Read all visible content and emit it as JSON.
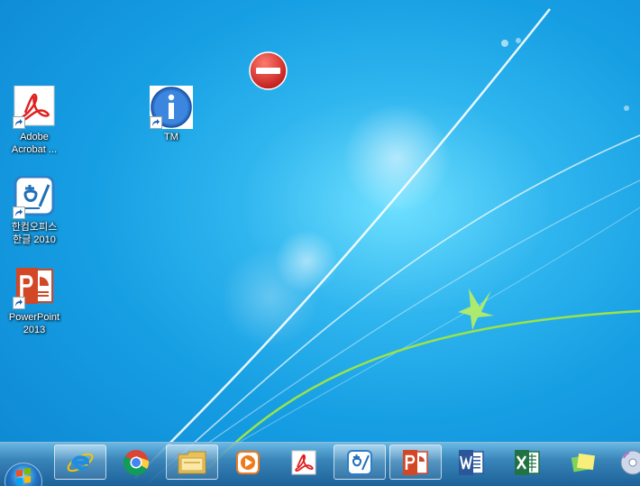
{
  "desktop": {
    "icons": [
      {
        "label1": "Adobe",
        "label2": "Acrobat ...",
        "icon": "pdf-icon"
      },
      {
        "label1": "TM",
        "label2": "",
        "icon": "info-icon"
      },
      {
        "label1": "한컴오피스",
        "label2": "한글 2010",
        "icon": "hangul-icon"
      },
      {
        "label1": "PowerPoint",
        "label2": "2013",
        "icon": "powerpoint-icon"
      }
    ],
    "overlay_icon": "no-entry-icon"
  },
  "taskbar": {
    "start": "windows-start-orb",
    "items": [
      {
        "icon": "internet-explorer-icon",
        "active": true
      },
      {
        "icon": "chrome-icon",
        "active": false
      },
      {
        "icon": "file-explorer-icon",
        "active": true
      },
      {
        "icon": "media-player-icon",
        "active": false
      },
      {
        "icon": "acrobat-icon",
        "active": false
      },
      {
        "icon": "hangul-icon",
        "active": true
      },
      {
        "icon": "powerpoint-icon",
        "active": true
      },
      {
        "icon": "word-icon",
        "active": false
      },
      {
        "icon": "excel-icon",
        "active": false
      },
      {
        "icon": "sticky-notes-icon",
        "active": false
      },
      {
        "icon": "disc-icon",
        "active": false
      }
    ]
  },
  "colors": {
    "wallpaper": "#169ee3",
    "powerpoint": "#d24726",
    "word": "#2b579a",
    "excel": "#217346",
    "acrobat": "#e02020",
    "no_entry": "#d7211f"
  }
}
